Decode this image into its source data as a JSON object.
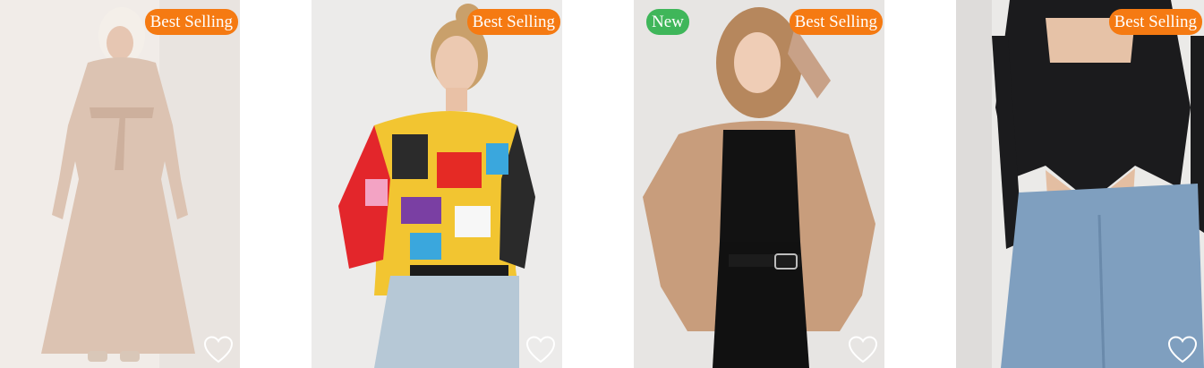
{
  "colors": {
    "best_selling_bg": "#f57a12",
    "new_bg": "#3fb65a",
    "heart_stroke": "#ffffff"
  },
  "icons": {
    "favorite": "heart-outline-icon"
  },
  "products": [
    {
      "badges": [
        {
          "label": "Best Selling",
          "type": "best"
        }
      ],
      "image_alt": "Beige belted maxi dress with long sleeves"
    },
    {
      "badges": [
        {
          "label": "Best Selling",
          "type": "best"
        }
      ],
      "image_alt": "Colorful abstract print shirt with light jeans"
    },
    {
      "badges": [
        {
          "label": "New",
          "type": "new"
        },
        {
          "label": "Best Selling",
          "type": "best"
        }
      ],
      "image_alt": "Camel oversized shirt over black top and black jeans"
    },
    {
      "badges": [
        {
          "label": "Best Selling",
          "type": "best"
        }
      ],
      "image_alt": "Black long-sleeve crop top with blue jeans"
    }
  ]
}
